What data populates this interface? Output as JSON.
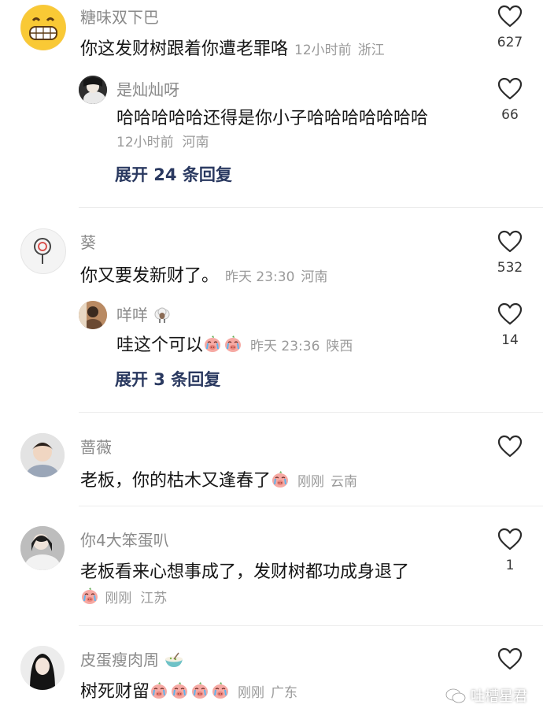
{
  "comments": [
    {
      "user": "糖味双下巴",
      "text": "你这发财树跟着你遭老罪咯",
      "time": "12小时前",
      "location": "浙江",
      "likes": "627",
      "reply": {
        "user": "是灿灿呀",
        "text": "哈哈哈哈哈还得是你小子哈哈哈哈哈哈哈",
        "time": "12小时前",
        "location": "河南",
        "likes": "66"
      },
      "expand": "展开 24 条回复"
    },
    {
      "user": "葵",
      "text": "你又要发新财了。",
      "time": "昨天 23:30",
      "location": "河南",
      "likes": "532",
      "reply": {
        "user": "咩咩",
        "text": "哇这个可以",
        "time": "昨天 23:36",
        "location": "陕西",
        "likes": "14"
      },
      "expand": "展开 3 条回复"
    },
    {
      "user": "蔷薇",
      "text": "老板，你的枯木又逢春了",
      "time": "刚刚",
      "location": "云南",
      "likes": ""
    },
    {
      "user": "你4大笨蛋叭",
      "text": "老板看来心想事成了，发财树都功成身退了",
      "time": "刚刚",
      "location": "江苏",
      "likes": "1"
    },
    {
      "user": "皮蛋瘦肉周",
      "text": "树死财留",
      "time": "刚刚",
      "location": "广东",
      "likes": ""
    }
  ],
  "watermark": "吐槽星君",
  "icons": {
    "like": "heart-outline-icon",
    "emoji": "crying-pig-emoji"
  },
  "colors": {
    "expand": "#2a3960",
    "meta": "#9a9a9a",
    "name": "#8a8a8a"
  }
}
